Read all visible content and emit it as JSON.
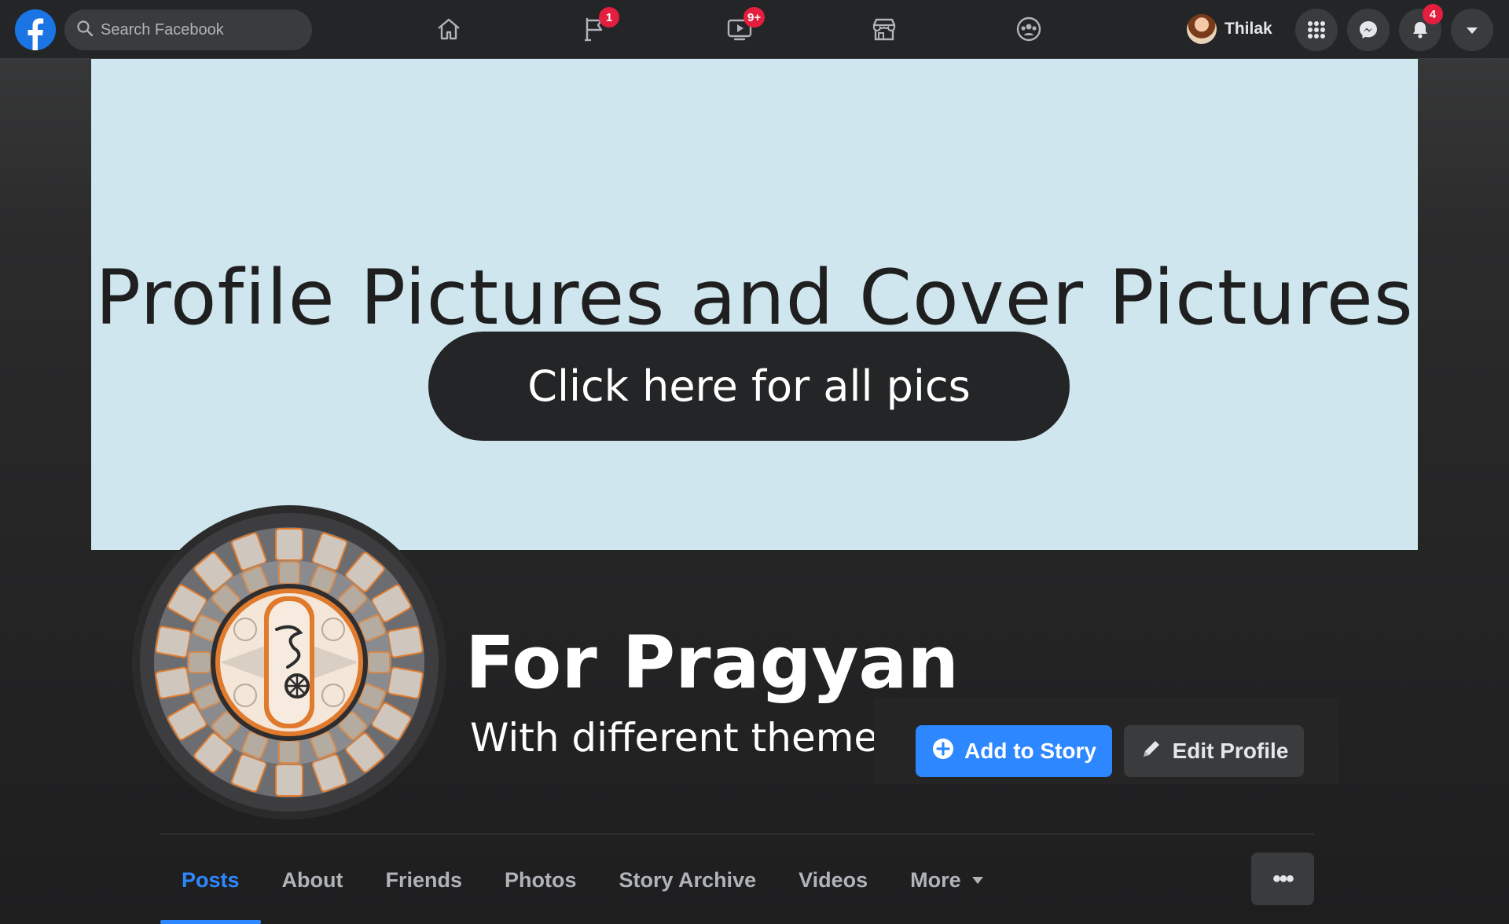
{
  "topbar": {
    "search_placeholder": "Search Facebook",
    "nav": {
      "pages_badge": "1",
      "watch_badge": "9+"
    },
    "profile_name": "Thilak",
    "notifications_badge": "4"
  },
  "cover": {
    "title": "Profile Pictures and Cover Pictures",
    "cta_label": "Click here for all pics"
  },
  "profile": {
    "name": "For Pragyan",
    "subtitle": "With different themes",
    "add_story_label": "Add to Story",
    "edit_profile_label": "Edit Profile"
  },
  "tabs": [
    {
      "label": "Posts"
    },
    {
      "label": "About"
    },
    {
      "label": "Friends"
    },
    {
      "label": "Photos"
    },
    {
      "label": "Story Archive"
    },
    {
      "label": "Videos"
    },
    {
      "label": "More"
    }
  ],
  "more_dots": "•••",
  "colors": {
    "accent": "#2d88ff",
    "badge": "#e41e3f",
    "cover_bg": "#cfe6ee",
    "topbar_bg": "#242526"
  },
  "icons": [
    "facebook-logo",
    "search-icon",
    "home-icon",
    "pages-flag-icon",
    "watch-icon",
    "marketplace-icon",
    "groups-icon",
    "menu-grid-icon",
    "messenger-icon",
    "bell-icon",
    "caret-down-icon",
    "plus-circle-icon",
    "pencil-icon"
  ]
}
